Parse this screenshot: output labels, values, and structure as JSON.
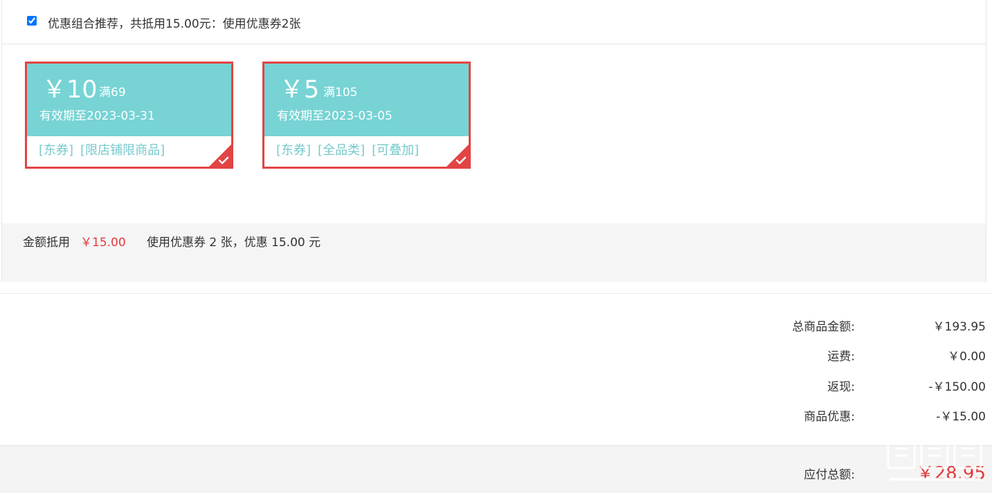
{
  "recommend": {
    "checked": true,
    "text": "优惠组合推荐，共抵用15.00元：使用优惠券2张"
  },
  "coupons": [
    {
      "amount": "￥10",
      "condition": "满69",
      "validity": "有效期至2023-03-31",
      "tags": [
        "[东券]",
        "[限店铺限商品]"
      ],
      "selected": true
    },
    {
      "amount": "￥5",
      "condition": "满105",
      "validity": "有效期至2023-03-05",
      "tags": [
        "[东券]",
        "[全品类]",
        "[可叠加]"
      ],
      "selected": true
    }
  ],
  "summary": {
    "label": "金额抵用",
    "amount": "￥15.00",
    "description": "使用优惠券 2 张，优惠 15.00 元"
  },
  "totals": [
    {
      "label": "总商品金额:",
      "value": "￥193.95"
    },
    {
      "label": "运费:",
      "value": "￥0.00"
    },
    {
      "label": "返现:",
      "value": "-￥150.00"
    },
    {
      "label": "商品优惠:",
      "value": "-￥15.00"
    }
  ],
  "payable": {
    "label": "应付总额:",
    "value": "￥28.95"
  },
  "colors": {
    "coupon_bg": "#77d3d4",
    "coupon_border": "#e24444",
    "accent_red": "#e4393c",
    "tag_text": "#77c9cc"
  }
}
